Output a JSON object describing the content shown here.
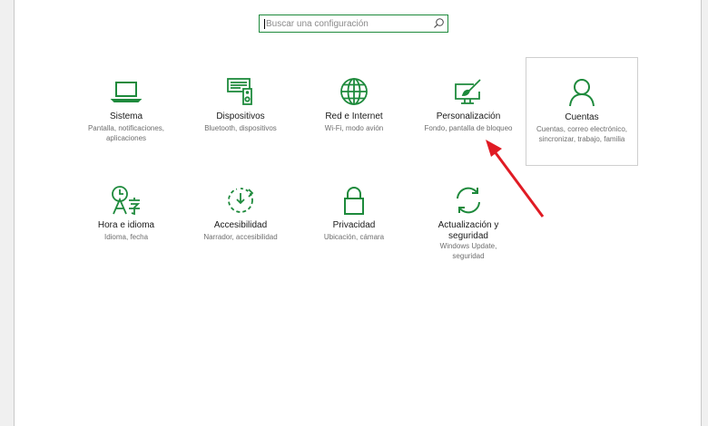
{
  "search": {
    "placeholder": "Buscar una configuración"
  },
  "tiles": [
    {
      "label": "Sistema",
      "desc": "Pantalla, notificaciones, aplicaciones",
      "icon": "laptop-icon"
    },
    {
      "label": "Dispositivos",
      "desc": "Bluetooth, dispositivos",
      "icon": "devices-icon"
    },
    {
      "label": "Red e Internet",
      "desc": "Wi-Fi, modo avión",
      "icon": "globe-icon"
    },
    {
      "label": "Personalización",
      "desc": "Fondo, pantalla de bloqueo",
      "icon": "paint-brush-icon"
    },
    {
      "label": "Cuentas",
      "desc": "Cuentas, correo electrónico, sincronizar, trabajo, familia",
      "icon": "person-icon"
    },
    {
      "label": "Hora e idioma",
      "desc": "Idioma, fecha",
      "icon": "time-language-icon"
    },
    {
      "label": "Accesibilidad",
      "desc": "Narrador, accesibilidad",
      "icon": "accessibility-icon"
    },
    {
      "label": "Privacidad",
      "desc": "Ubicación, cámara",
      "icon": "lock-icon"
    },
    {
      "label": "Actualización y seguridad",
      "desc": "Windows Update, seguridad",
      "icon": "sync-icon"
    }
  ],
  "colors": {
    "accent": "#1e8a3c",
    "annotation_arrow": "#e01b24"
  }
}
